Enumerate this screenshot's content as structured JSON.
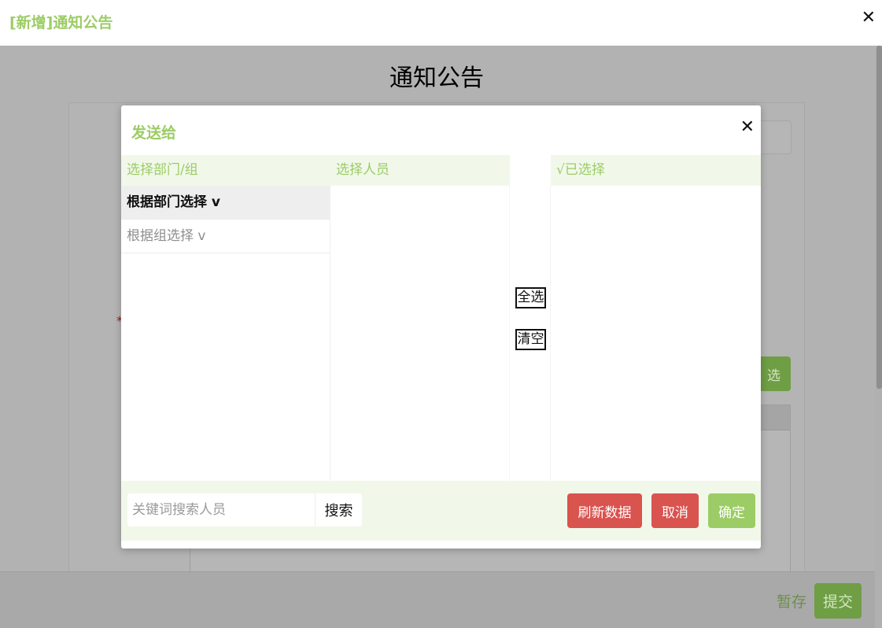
{
  "window": {
    "title": "[新增]通知公告",
    "close_symbol": "✕"
  },
  "page": {
    "title": "通知公告",
    "required_marker": "*",
    "select_button_label": "选",
    "footer": {
      "draft_label": "暂存",
      "submit_label": "提交"
    }
  },
  "modal": {
    "title": "发送给",
    "close_symbol": "✕",
    "columns": {
      "dept": "选择部门/组",
      "people": "选择人员",
      "selected": "√已选择"
    },
    "dept_items": [
      {
        "label": "根据部门选择 v",
        "active": true
      },
      {
        "label": "根据组选择 v",
        "active": false
      }
    ],
    "select_all_label": "全选",
    "clear_label": "清空",
    "footer": {
      "search_placeholder": "关键词搜索人员",
      "search_value": "",
      "search_button": "搜索",
      "refresh_button": "刷新数据",
      "cancel_button": "取消",
      "ok_button": "确定"
    }
  },
  "colors": {
    "accent_green": "#9ccc65",
    "danger_red": "#d9534f",
    "header_tint": "#f1f8ea"
  }
}
